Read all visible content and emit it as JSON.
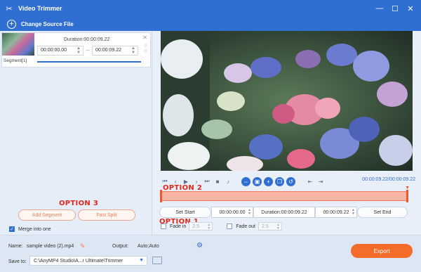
{
  "window": {
    "title": "Video Trimmer",
    "controls": [
      "—",
      "☐",
      "✕"
    ]
  },
  "toolbar": {
    "change_source_label": "Change Source File"
  },
  "segment": {
    "label": "Segment[1]",
    "duration": "Duration:00:00:09.22",
    "start": "00:00:00.00",
    "end": "00:00:09.22"
  },
  "annotations": {
    "option1": "OPTION 1",
    "option2": "OPTION 2",
    "option3": "OPTION 3"
  },
  "left_actions": {
    "add_segment": "Add Segment",
    "fast_split": "Fast Split",
    "merge_label": "Merge into one",
    "merge_checked": true
  },
  "player": {
    "time_readout": "00:00:09.22/00:00:09.22"
  },
  "range": {
    "set_start": "Set Start",
    "start_time": "00:00:00.00",
    "duration": "Duration:00:00:09.22",
    "end_time": "00:00:09.22",
    "set_end": "Set End"
  },
  "fade": {
    "fade_in_label": "Fade in",
    "fade_in_value": "2.5",
    "fade_out_label": "Fade out",
    "fade_out_value": "2.5"
  },
  "output": {
    "name_label": "Name:",
    "name_value": "sample video (2).mp4",
    "output_label": "Output:",
    "output_value": "Auto;Auto",
    "save_label": "Save to:",
    "save_path": "C:\\AnyMP4 Studio\\A...r Ultimate\\Trimmer",
    "export_label": "Export"
  },
  "colors": {
    "accent": "#2f6fd1",
    "export": "#f36c2a",
    "annotation": "#e0271a"
  }
}
